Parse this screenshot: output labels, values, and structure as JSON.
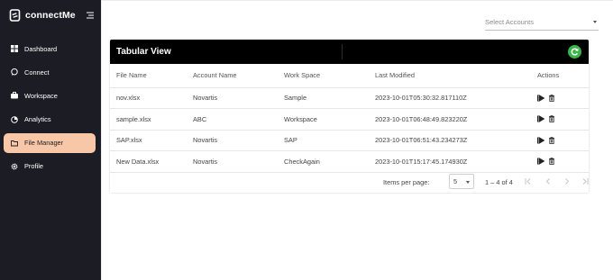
{
  "brand": {
    "name": "connectMe"
  },
  "sidebar": {
    "items": [
      {
        "label": "Dashboard",
        "icon": "dashboard-icon",
        "active": false
      },
      {
        "label": "Connect",
        "icon": "chat-icon",
        "active": false
      },
      {
        "label": "Workspace",
        "icon": "briefcase-icon",
        "active": false
      },
      {
        "label": "Analytics",
        "icon": "pie-chart-icon",
        "active": false
      },
      {
        "label": "File Manager",
        "icon": "folder-icon",
        "active": true
      },
      {
        "label": "Profile",
        "icon": "gear-icon",
        "active": false
      }
    ],
    "active_color": "#f8c7a7",
    "bg_color": "#1c1c24"
  },
  "accounts": {
    "placeholder": "Select Accounts"
  },
  "table_view": {
    "title": "Tabular View",
    "refresh_icon": "refresh-icon",
    "refresh_color": "#3bb54a",
    "columns": [
      "File Name",
      "Account Name",
      "Work Space",
      "Last Modified",
      "Actions"
    ],
    "rows": [
      {
        "file": "nov.xlsx",
        "account": "Novartis",
        "workspace": "Sample",
        "modified": "2023-10-01T05:30:32.817110Z"
      },
      {
        "file": "sample.xlsx",
        "account": "ABC",
        "workspace": "Workspace",
        "modified": "2023-10-01T06:48:49.823220Z"
      },
      {
        "file": "SAP.xlsx",
        "account": "Novartis",
        "workspace": "SAP",
        "modified": "2023-10-01T06:51:43.234273Z"
      },
      {
        "file": "New Data.xlsx",
        "account": "Novartis",
        "workspace": "CheckAgain",
        "modified": "2023-10-01T15:17:45.174930Z"
      }
    ],
    "row_actions": [
      "play-icon",
      "trash-icon"
    ]
  },
  "pagination": {
    "items_label": "Items per page:",
    "page_size": "5",
    "range": "1 – 4 of 4"
  }
}
